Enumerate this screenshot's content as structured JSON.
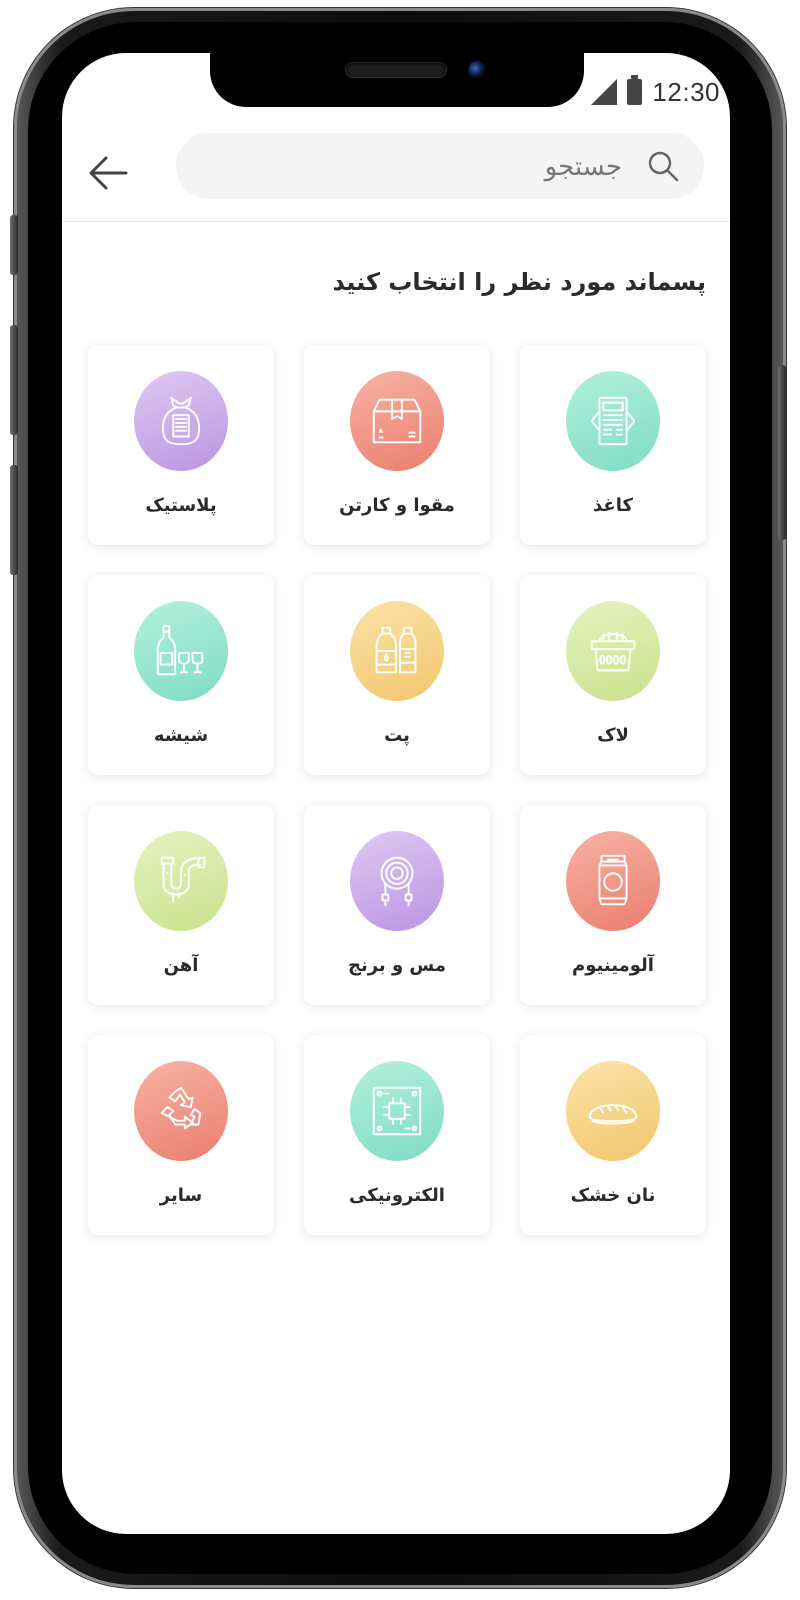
{
  "status_bar": {
    "time": "12:30"
  },
  "header": {
    "search_placeholder": "جستجو"
  },
  "page_title": "پسماند مورد نظر را انتخاب کنید",
  "categories": [
    {
      "label": "کاغذ",
      "icon": "newspaper-icon",
      "color_from": "#b3f0dc",
      "color_to": "#7fdcc3"
    },
    {
      "label": "مقوا و کارتن",
      "icon": "cardboard-box-icon",
      "color_from": "#f7b3a4",
      "color_to": "#ea7e6e"
    },
    {
      "label": "پلاستیک",
      "icon": "plastic-bag-icon",
      "color_from": "#e0c8f3",
      "color_to": "#b995e2"
    },
    {
      "label": "لاک",
      "icon": "basket-icon",
      "color_from": "#e6f2c0",
      "color_to": "#c9e28d"
    },
    {
      "label": "پت",
      "icon": "pet-bottles-icon",
      "color_from": "#fbe3a8",
      "color_to": "#f2c66d"
    },
    {
      "label": "شیشه",
      "icon": "glass-bottle-icon",
      "color_from": "#b3f0dc",
      "color_to": "#7fdcc3"
    },
    {
      "label": "آلومینیوم",
      "icon": "can-icon",
      "color_from": "#f7b3a4",
      "color_to": "#ea7e6e"
    },
    {
      "label": "مس و برنج",
      "icon": "cable-icon",
      "color_from": "#e0c8f3",
      "color_to": "#b995e2"
    },
    {
      "label": "آهن",
      "icon": "pipe-icon",
      "color_from": "#e6f2c0",
      "color_to": "#c9e28d"
    },
    {
      "label": "نان خشک",
      "icon": "bread-icon",
      "color_from": "#fbe3a8",
      "color_to": "#f2c66d"
    },
    {
      "label": "الکترونیکی",
      "icon": "circuit-board-icon",
      "color_from": "#b3f0dc",
      "color_to": "#7fdcc3"
    },
    {
      "label": "سایر",
      "icon": "recycle-icon",
      "color_from": "#f7b3a4",
      "color_to": "#ea7e6e"
    }
  ]
}
